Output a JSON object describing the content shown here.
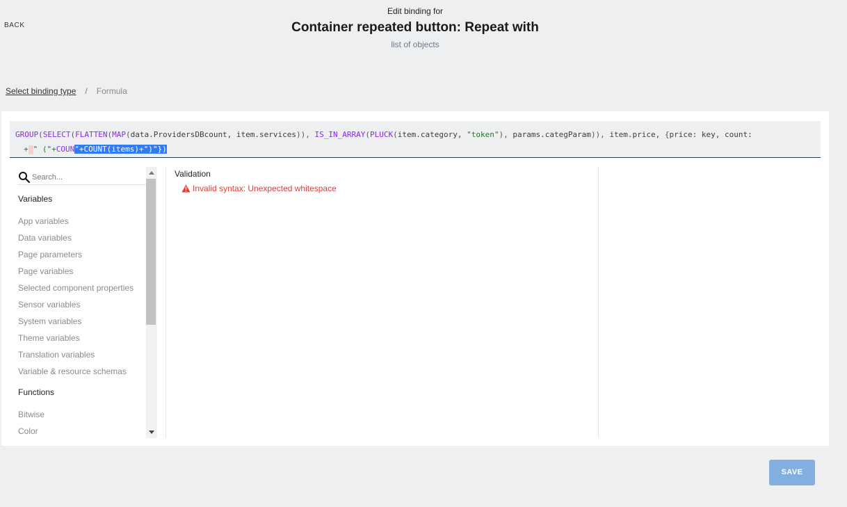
{
  "header": {
    "back_label": "BACK",
    "subtitle": "Edit binding for",
    "title": "Container repeated button: Repeat with",
    "subtitle2": "list of objects"
  },
  "breadcrumb": {
    "link": "Select binding type",
    "separator": "/",
    "current": "Formula"
  },
  "formula": {
    "line1": [
      {
        "t": "fn",
        "v": "GROUP"
      },
      {
        "t": "pn",
        "v": "("
      },
      {
        "t": "fn",
        "v": "SELECT"
      },
      {
        "t": "pn",
        "v": "("
      },
      {
        "t": "fn",
        "v": "FLATTEN"
      },
      {
        "t": "pn",
        "v": "("
      },
      {
        "t": "fn",
        "v": "MAP"
      },
      {
        "t": "pn",
        "v": "("
      },
      {
        "t": "id",
        "v": "data.ProvidersDBcount, item.services"
      },
      {
        "t": "pn",
        "v": ")), "
      },
      {
        "t": "fn",
        "v": "IS_IN_ARRAY"
      },
      {
        "t": "pn",
        "v": "("
      },
      {
        "t": "fn",
        "v": "PLUCK"
      },
      {
        "t": "pn",
        "v": "("
      },
      {
        "t": "id",
        "v": "item.category, "
      },
      {
        "t": "str",
        "v": "\"token\""
      },
      {
        "t": "pn",
        "v": "), "
      },
      {
        "t": "id",
        "v": "params.categParam"
      },
      {
        "t": "pn",
        "v": ")), "
      },
      {
        "t": "id",
        "v": "item.price, "
      },
      {
        "t": "pn",
        "v": "{"
      },
      {
        "t": "id",
        "v": "price: key, count:"
      }
    ],
    "line2": [
      {
        "t": "pn",
        "v": "+"
      },
      {
        "t": "err",
        "v": ""
      },
      {
        "t": "str",
        "v": "\" (\"+"
      },
      {
        "t": "fn",
        "v": "COUN"
      },
      {
        "t": "sel",
        "v": "\"+COUNT(items)+\")\"})"
      }
    ]
  },
  "sidebar": {
    "search_placeholder": "Search...",
    "variables_heading": "Variables",
    "variables": [
      "App variables",
      "Data variables",
      "Page parameters",
      "Page variables",
      "Selected component properties",
      "Sensor variables",
      "System variables",
      "Theme variables",
      "Translation variables",
      "Variable & resource schemas"
    ],
    "functions_heading": "Functions",
    "functions": [
      "Bitwise",
      "Color"
    ]
  },
  "validation": {
    "label": "Validation",
    "error": "Invalid syntax: Unexpected whitespace",
    "error_color": "#e53935"
  },
  "actions": {
    "save_label": "SAVE",
    "save_color": "#82aee0"
  }
}
